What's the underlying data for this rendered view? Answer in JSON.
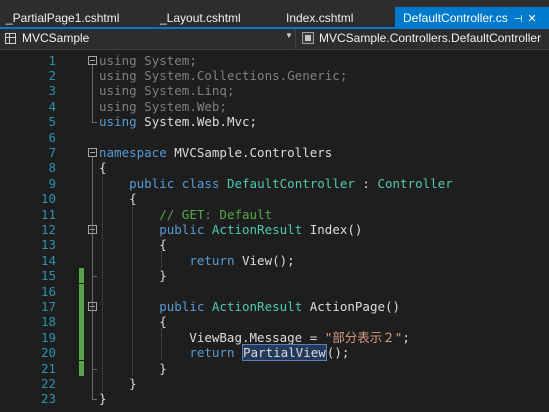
{
  "tabs": [
    {
      "label": "_PartialPage1.cshtml",
      "active": false
    },
    {
      "label": "_Layout.cshtml",
      "active": false
    },
    {
      "label": "Index.cshtml",
      "active": false
    },
    {
      "label": "DefaultController.cs",
      "active": true
    }
  ],
  "nav": {
    "project": "MVCSample",
    "namespace_class": "MVCSample.Controllers.DefaultController"
  },
  "code": {
    "line_numbers": [
      "1",
      "2",
      "3",
      "4",
      "5",
      "6",
      "7",
      "8",
      "9",
      "10",
      "11",
      "12",
      "13",
      "14",
      "15",
      "16",
      "17",
      "18",
      "19",
      "20",
      "21",
      "22",
      "23"
    ],
    "lines": [
      {
        "segs": [
          {
            "t": "using",
            "c": "dim"
          },
          {
            "t": " System;",
            "c": "dim"
          }
        ]
      },
      {
        "segs": [
          {
            "t": "using",
            "c": "dim"
          },
          {
            "t": " System.Collections.Generic;",
            "c": "dim"
          }
        ]
      },
      {
        "segs": [
          {
            "t": "using",
            "c": "dim"
          },
          {
            "t": " System.Linq;",
            "c": "dim"
          }
        ]
      },
      {
        "segs": [
          {
            "t": "using",
            "c": "dim"
          },
          {
            "t": " System.Web;",
            "c": "dim"
          }
        ]
      },
      {
        "segs": [
          {
            "t": "using",
            "c": "kw"
          },
          {
            "t": " System.Web.Mvc;",
            "c": ""
          }
        ]
      },
      {
        "segs": []
      },
      {
        "segs": [
          {
            "t": "namespace",
            "c": "kw"
          },
          {
            "t": " MVCSample.Controllers",
            "c": ""
          }
        ]
      },
      {
        "segs": [
          {
            "t": "{",
            "c": ""
          }
        ]
      },
      {
        "segs": [
          {
            "t": "    ",
            "c": ""
          },
          {
            "t": "public",
            "c": "kw"
          },
          {
            "t": " ",
            "c": ""
          },
          {
            "t": "class",
            "c": "kw"
          },
          {
            "t": " ",
            "c": ""
          },
          {
            "t": "DefaultController",
            "c": "ty"
          },
          {
            "t": " : ",
            "c": ""
          },
          {
            "t": "Controller",
            "c": "ty"
          }
        ]
      },
      {
        "segs": [
          {
            "t": "    {",
            "c": ""
          }
        ]
      },
      {
        "segs": [
          {
            "t": "        ",
            "c": ""
          },
          {
            "t": "// GET: Default",
            "c": "cm"
          }
        ]
      },
      {
        "segs": [
          {
            "t": "        ",
            "c": ""
          },
          {
            "t": "public",
            "c": "kw"
          },
          {
            "t": " ",
            "c": ""
          },
          {
            "t": "ActionResult",
            "c": "ty"
          },
          {
            "t": " Index()",
            "c": ""
          }
        ]
      },
      {
        "segs": [
          {
            "t": "        {",
            "c": ""
          }
        ]
      },
      {
        "segs": [
          {
            "t": "            ",
            "c": ""
          },
          {
            "t": "return",
            "c": "kw"
          },
          {
            "t": " View();",
            "c": ""
          }
        ]
      },
      {
        "segs": [
          {
            "t": "        }",
            "c": ""
          }
        ]
      },
      {
        "segs": []
      },
      {
        "segs": [
          {
            "t": "        ",
            "c": ""
          },
          {
            "t": "public",
            "c": "kw"
          },
          {
            "t": " ",
            "c": ""
          },
          {
            "t": "ActionResult",
            "c": "ty"
          },
          {
            "t": " ActionPage()",
            "c": ""
          }
        ]
      },
      {
        "segs": [
          {
            "t": "        {",
            "c": ""
          }
        ]
      },
      {
        "segs": [
          {
            "t": "            ViewBag.Message = ",
            "c": ""
          },
          {
            "t": "\"部分表示２\"",
            "c": "st"
          },
          {
            "t": ";",
            "c": ""
          }
        ]
      },
      {
        "segs": [
          {
            "t": "            ",
            "c": ""
          },
          {
            "t": "return",
            "c": "kw"
          },
          {
            "t": " ",
            "c": ""
          },
          {
            "t": "PartialView",
            "c": "sel"
          },
          {
            "t": "();",
            "c": ""
          }
        ]
      },
      {
        "segs": [
          {
            "t": "        }",
            "c": ""
          }
        ]
      },
      {
        "segs": [
          {
            "t": "    }",
            "c": ""
          }
        ]
      },
      {
        "segs": [
          {
            "t": "}",
            "c": ""
          }
        ]
      }
    ]
  }
}
